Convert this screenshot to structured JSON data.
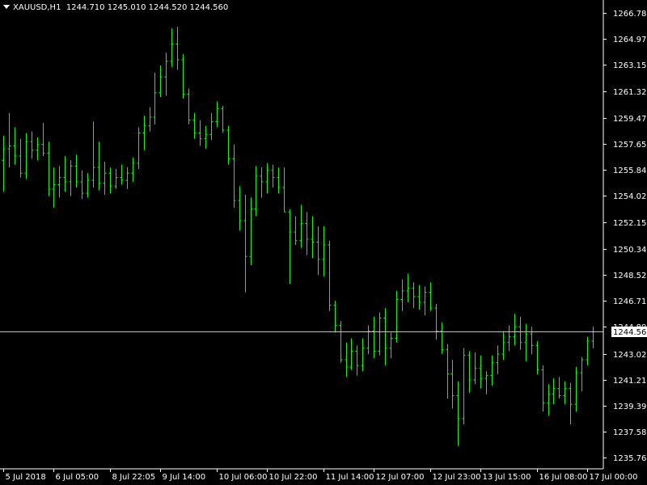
{
  "header": {
    "symbol": "XAUUSD,H1",
    "open": "1244.710",
    "high": "1245.010",
    "low": "1244.520",
    "close": "1244.560"
  },
  "colors": {
    "background": "#000000",
    "bars": "#00ff00",
    "axis": "#ffffff",
    "price_line": "#c0c0c0",
    "price_box": "#ffffff"
  },
  "chart_data": {
    "type": "bar",
    "subtype": "ohlc",
    "ylim": [
      1235.0,
      1267.5
    ],
    "y_ticks": [
      "1266.785",
      "1264.970",
      "1263.155",
      "1261.320",
      "1259.470",
      "1257.655",
      "1255.840",
      "1254.025",
      "1252.155",
      "1250.340",
      "1248.525",
      "1246.710",
      "1244.895",
      "1243.025",
      "1241.210",
      "1239.395",
      "1237.580",
      "1235.765"
    ],
    "x_ticks": [
      "5 Jul 2018",
      "6 Jul 05:00",
      "8 Jul 22:05",
      "9 Jul 14:00",
      "10 Jul 06:00",
      "10 Jul 22:00",
      "11 Jul 14:00",
      "12 Jul 07:00",
      "12 Jul 23:00",
      "13 Jul 15:00",
      "16 Jul 08:00",
      "17 Jul 00:00"
    ],
    "current_price": "1244.560",
    "bars": [
      [
        1256.5,
        1258.2,
        1254.3,
        1257.3
      ],
      [
        1257.3,
        1259.8,
        1256.0,
        1257.5
      ],
      [
        1257.5,
        1258.8,
        1256.2,
        1256.8
      ],
      [
        1256.8,
        1258.0,
        1255.3,
        1255.6
      ],
      [
        1255.6,
        1258.4,
        1255.2,
        1257.8
      ],
      [
        1257.8,
        1258.5,
        1256.6,
        1257.2
      ],
      [
        1257.2,
        1258.1,
        1256.5,
        1257.6
      ],
      [
        1257.6,
        1259.1,
        1256.8,
        1257.0
      ],
      [
        1257.0,
        1257.8,
        1254.0,
        1254.5
      ],
      [
        1254.5,
        1256.0,
        1253.2,
        1254.8
      ],
      [
        1254.8,
        1256.1,
        1253.9,
        1255.3
      ],
      [
        1255.3,
        1256.8,
        1254.3,
        1255.0
      ],
      [
        1255.0,
        1256.5,
        1254.0,
        1256.1
      ],
      [
        1256.1,
        1256.9,
        1254.6,
        1255.0
      ],
      [
        1255.0,
        1255.8,
        1253.8,
        1254.2
      ],
      [
        1254.2,
        1255.6,
        1253.9,
        1255.1
      ],
      [
        1255.1,
        1259.2,
        1254.6,
        1256.0
      ],
      [
        1256.0,
        1257.8,
        1254.4,
        1254.9
      ],
      [
        1254.9,
        1256.4,
        1254.1,
        1255.6
      ],
      [
        1255.6,
        1256.0,
        1254.2,
        1254.7
      ],
      [
        1254.7,
        1255.9,
        1254.5,
        1255.3
      ],
      [
        1255.3,
        1256.2,
        1254.8,
        1255.1
      ],
      [
        1255.1,
        1256.0,
        1254.5,
        1255.6
      ],
      [
        1255.6,
        1256.7,
        1255.0,
        1256.3
      ],
      [
        1256.3,
        1258.8,
        1255.9,
        1258.4
      ],
      [
        1258.4,
        1259.6,
        1257.2,
        1258.9
      ],
      [
        1258.9,
        1260.2,
        1258.5,
        1259.5
      ],
      [
        1259.5,
        1262.6,
        1259.0,
        1261.2
      ],
      [
        1261.2,
        1263.1,
        1260.9,
        1262.3
      ],
      [
        1262.3,
        1264.0,
        1261.0,
        1263.4
      ],
      [
        1263.4,
        1265.7,
        1263.0,
        1264.6
      ],
      [
        1264.6,
        1265.8,
        1262.8,
        1263.5
      ],
      [
        1263.5,
        1263.9,
        1260.8,
        1261.1
      ],
      [
        1261.1,
        1261.5,
        1259.0,
        1259.3
      ],
      [
        1259.3,
        1259.8,
        1258.0,
        1258.4
      ],
      [
        1258.4,
        1259.3,
        1257.5,
        1258.0
      ],
      [
        1258.0,
        1258.9,
        1257.3,
        1258.3
      ],
      [
        1258.3,
        1259.8,
        1257.9,
        1259.2
      ],
      [
        1259.2,
        1260.6,
        1258.8,
        1260.1
      ],
      [
        1260.1,
        1260.3,
        1258.4,
        1258.6
      ],
      [
        1258.6,
        1258.9,
        1256.2,
        1256.6
      ],
      [
        1256.6,
        1257.6,
        1253.2,
        1253.7
      ],
      [
        1253.7,
        1254.7,
        1251.6,
        1252.3
      ],
      [
        1252.3,
        1254.1,
        1247.3,
        1249.8
      ],
      [
        1249.8,
        1253.9,
        1249.2,
        1253.1
      ],
      [
        1253.1,
        1256.1,
        1252.6,
        1255.4
      ],
      [
        1255.4,
        1256.0,
        1253.9,
        1255.0
      ],
      [
        1255.0,
        1256.3,
        1254.2,
        1255.8
      ],
      [
        1255.8,
        1256.2,
        1254.6,
        1255.3
      ],
      [
        1255.3,
        1256.0,
        1254.2,
        1254.6
      ],
      [
        1254.6,
        1256.0,
        1252.9,
        1252.9
      ],
      [
        1252.9,
        1253.1,
        1247.9,
        1251.5
      ],
      [
        1251.5,
        1252.6,
        1250.6,
        1250.9
      ],
      [
        1250.9,
        1253.4,
        1250.4,
        1252.1
      ],
      [
        1252.1,
        1252.9,
        1249.9,
        1251.0
      ],
      [
        1251.0,
        1252.6,
        1249.7,
        1250.8
      ],
      [
        1250.8,
        1251.9,
        1248.5,
        1249.6
      ],
      [
        1249.6,
        1251.9,
        1248.4,
        1250.6
      ],
      [
        1250.6,
        1250.9,
        1246.0,
        1246.4
      ],
      [
        1246.4,
        1246.7,
        1244.5,
        1245.0
      ],
      [
        1245.0,
        1245.3,
        1242.4,
        1242.6
      ],
      [
        1242.6,
        1243.8,
        1241.4,
        1242.1
      ],
      [
        1242.1,
        1244.1,
        1241.9,
        1243.2
      ],
      [
        1243.2,
        1243.6,
        1241.5,
        1242.2
      ],
      [
        1242.2,
        1244.1,
        1241.8,
        1243.4
      ],
      [
        1243.4,
        1245.0,
        1243.0,
        1244.6
      ],
      [
        1244.6,
        1245.6,
        1242.7,
        1243.2
      ],
      [
        1243.2,
        1245.9,
        1242.9,
        1245.5
      ],
      [
        1245.5,
        1246.2,
        1242.2,
        1243.4
      ],
      [
        1243.4,
        1244.5,
        1242.7,
        1244.1
      ],
      [
        1244.1,
        1247.4,
        1243.8,
        1246.8
      ],
      [
        1246.8,
        1248.2,
        1246.0,
        1247.4
      ],
      [
        1247.4,
        1248.6,
        1246.6,
        1247.6
      ],
      [
        1247.6,
        1248.0,
        1246.2,
        1247.0
      ],
      [
        1247.0,
        1247.8,
        1246.1,
        1246.6
      ],
      [
        1246.6,
        1247.7,
        1245.7,
        1247.3
      ],
      [
        1247.3,
        1248.0,
        1246.0,
        1246.2
      ],
      [
        1246.2,
        1246.5,
        1244.0,
        1244.6
      ],
      [
        1244.6,
        1245.2,
        1243.0,
        1243.3
      ],
      [
        1243.3,
        1243.7,
        1239.9,
        1241.6
      ],
      [
        1241.6,
        1242.6,
        1239.2,
        1240.1
      ],
      [
        1240.1,
        1241.1,
        1236.6,
        1238.5
      ],
      [
        1238.5,
        1243.4,
        1238.1,
        1242.9
      ],
      [
        1242.9,
        1243.2,
        1240.3,
        1241.2
      ],
      [
        1241.2,
        1243.1,
        1240.9,
        1242.0
      ],
      [
        1242.0,
        1242.9,
        1240.6,
        1241.3
      ],
      [
        1241.3,
        1241.8,
        1240.2,
        1241.5
      ],
      [
        1241.5,
        1242.9,
        1240.8,
        1242.4
      ],
      [
        1242.4,
        1243.6,
        1241.6,
        1243.0
      ],
      [
        1243.0,
        1244.6,
        1242.6,
        1243.8
      ],
      [
        1243.8,
        1245.0,
        1243.2,
        1244.2
      ],
      [
        1244.2,
        1245.8,
        1243.6,
        1244.9
      ],
      [
        1244.9,
        1245.6,
        1243.3,
        1243.8
      ],
      [
        1243.8,
        1245.1,
        1242.5,
        1244.4
      ],
      [
        1244.4,
        1244.9,
        1243.0,
        1243.6
      ],
      [
        1243.6,
        1243.9,
        1241.6,
        1241.9
      ],
      [
        1241.9,
        1242.2,
        1239.0,
        1239.6
      ],
      [
        1239.6,
        1240.9,
        1238.7,
        1240.2
      ],
      [
        1240.2,
        1241.3,
        1239.5,
        1240.6
      ],
      [
        1240.6,
        1241.4,
        1239.9,
        1240.1
      ],
      [
        1240.1,
        1241.1,
        1239.5,
        1240.6
      ],
      [
        1240.6,
        1241.0,
        1238.1,
        1239.5
      ],
      [
        1239.5,
        1242.1,
        1239.0,
        1241.7
      ],
      [
        1241.7,
        1242.8,
        1240.4,
        1242.6
      ],
      [
        1242.6,
        1244.2,
        1242.2,
        1243.9
      ],
      [
        1243.9,
        1244.9,
        1243.4,
        1244.56
      ]
    ]
  }
}
